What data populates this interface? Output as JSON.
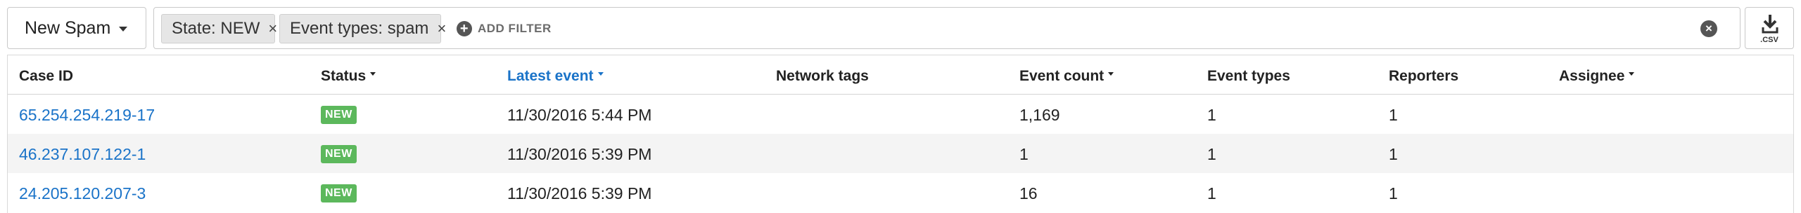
{
  "toolbar": {
    "view_label": "New Spam",
    "filters": [
      {
        "label": "State: NEW",
        "remove": "×"
      },
      {
        "label": "Event types: spam",
        "remove": "×"
      }
    ],
    "add_filter_label": "ADD FILTER",
    "clear_symbol": "×",
    "csv_label": ".CSV"
  },
  "table": {
    "columns": [
      {
        "label": "Case ID",
        "sortable": false
      },
      {
        "label": "Status",
        "sortable": true
      },
      {
        "label": "Latest event",
        "sortable": true,
        "active": true
      },
      {
        "label": "Network tags",
        "sortable": false
      },
      {
        "label": "Event count",
        "sortable": true
      },
      {
        "label": "Event types",
        "sortable": false
      },
      {
        "label": "Reporters",
        "sortable": false
      },
      {
        "label": "Assignee",
        "sortable": true
      }
    ],
    "rows": [
      {
        "case_id": "65.254.254.219-17",
        "status": "NEW",
        "latest_event": "11/30/2016 5:44 PM",
        "network_tags": "",
        "event_count": "1,169",
        "event_types": "1",
        "reporters": "1",
        "assignee": ""
      },
      {
        "case_id": "46.237.107.122-1",
        "status": "NEW",
        "latest_event": "11/30/2016 5:39 PM",
        "network_tags": "",
        "event_count": "1",
        "event_types": "1",
        "reporters": "1",
        "assignee": ""
      },
      {
        "case_id": "24.205.120.207-3",
        "status": "NEW",
        "latest_event": "11/30/2016 5:39 PM",
        "network_tags": "",
        "event_count": "16",
        "event_types": "1",
        "reporters": "1",
        "assignee": ""
      }
    ]
  },
  "colors": {
    "link": "#1a73c8",
    "status_new": "#5cb85c",
    "row_alt": "#f4f4f4"
  }
}
